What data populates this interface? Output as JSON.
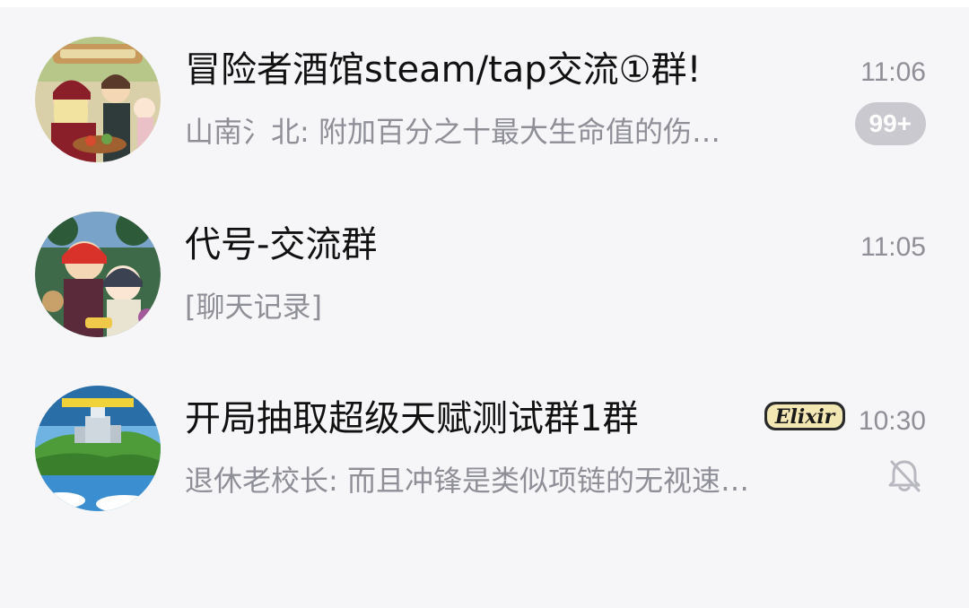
{
  "chats": [
    {
      "title": "冒险者酒馆steam/tap交流①群!",
      "preview": "山南氵北: 附加百分之十最大生命值的伤…",
      "time": "11:06",
      "unread": "99+"
    },
    {
      "title": "代号-交流群",
      "preview": "[聊天记录]",
      "time": "11:05"
    },
    {
      "title": "开局抽取超级天赋测试群1群",
      "preview": "退休老校长: 而且冲锋是类似项链的无视速…",
      "time": "10:30",
      "logo_text": "Elixir",
      "muted": true
    }
  ],
  "colors": {
    "background": "#f6f6f8",
    "title": "#111111",
    "secondary": "#8f8f98",
    "badge": "#c9c9cf"
  },
  "icons": {
    "mute": "bell-off-icon"
  }
}
